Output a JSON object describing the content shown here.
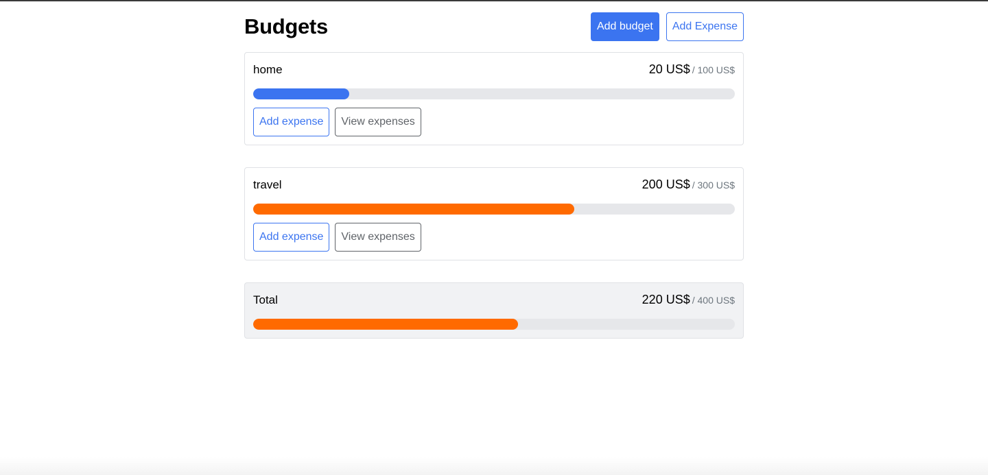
{
  "header": {
    "title": "Budgets",
    "add_budget_label": "Add budget",
    "add_expense_label": "Add Expense"
  },
  "budgets": [
    {
      "name": "home",
      "amount": "20 US$",
      "max": "/ 100 US$",
      "progress_fraction": 0.2,
      "bar_color": "#3b74f0",
      "add_expense_label": "Add expense",
      "view_expenses_label": "View expenses"
    },
    {
      "name": "travel",
      "amount": "200 US$",
      "max": "/ 300 US$",
      "progress_fraction": 0.6667,
      "bar_color": "#ff6a00",
      "add_expense_label": "Add expense",
      "view_expenses_label": "View expenses"
    }
  ],
  "total": {
    "name": "Total",
    "amount": "220 US$",
    "max": "/ 400 US$",
    "progress_fraction": 0.55,
    "bar_color": "#ff6a00"
  },
  "colors": {
    "primary": "#3b74f0",
    "warning": "#ff6a00",
    "track": "#e6e7ea",
    "muted": "#6c757d"
  }
}
